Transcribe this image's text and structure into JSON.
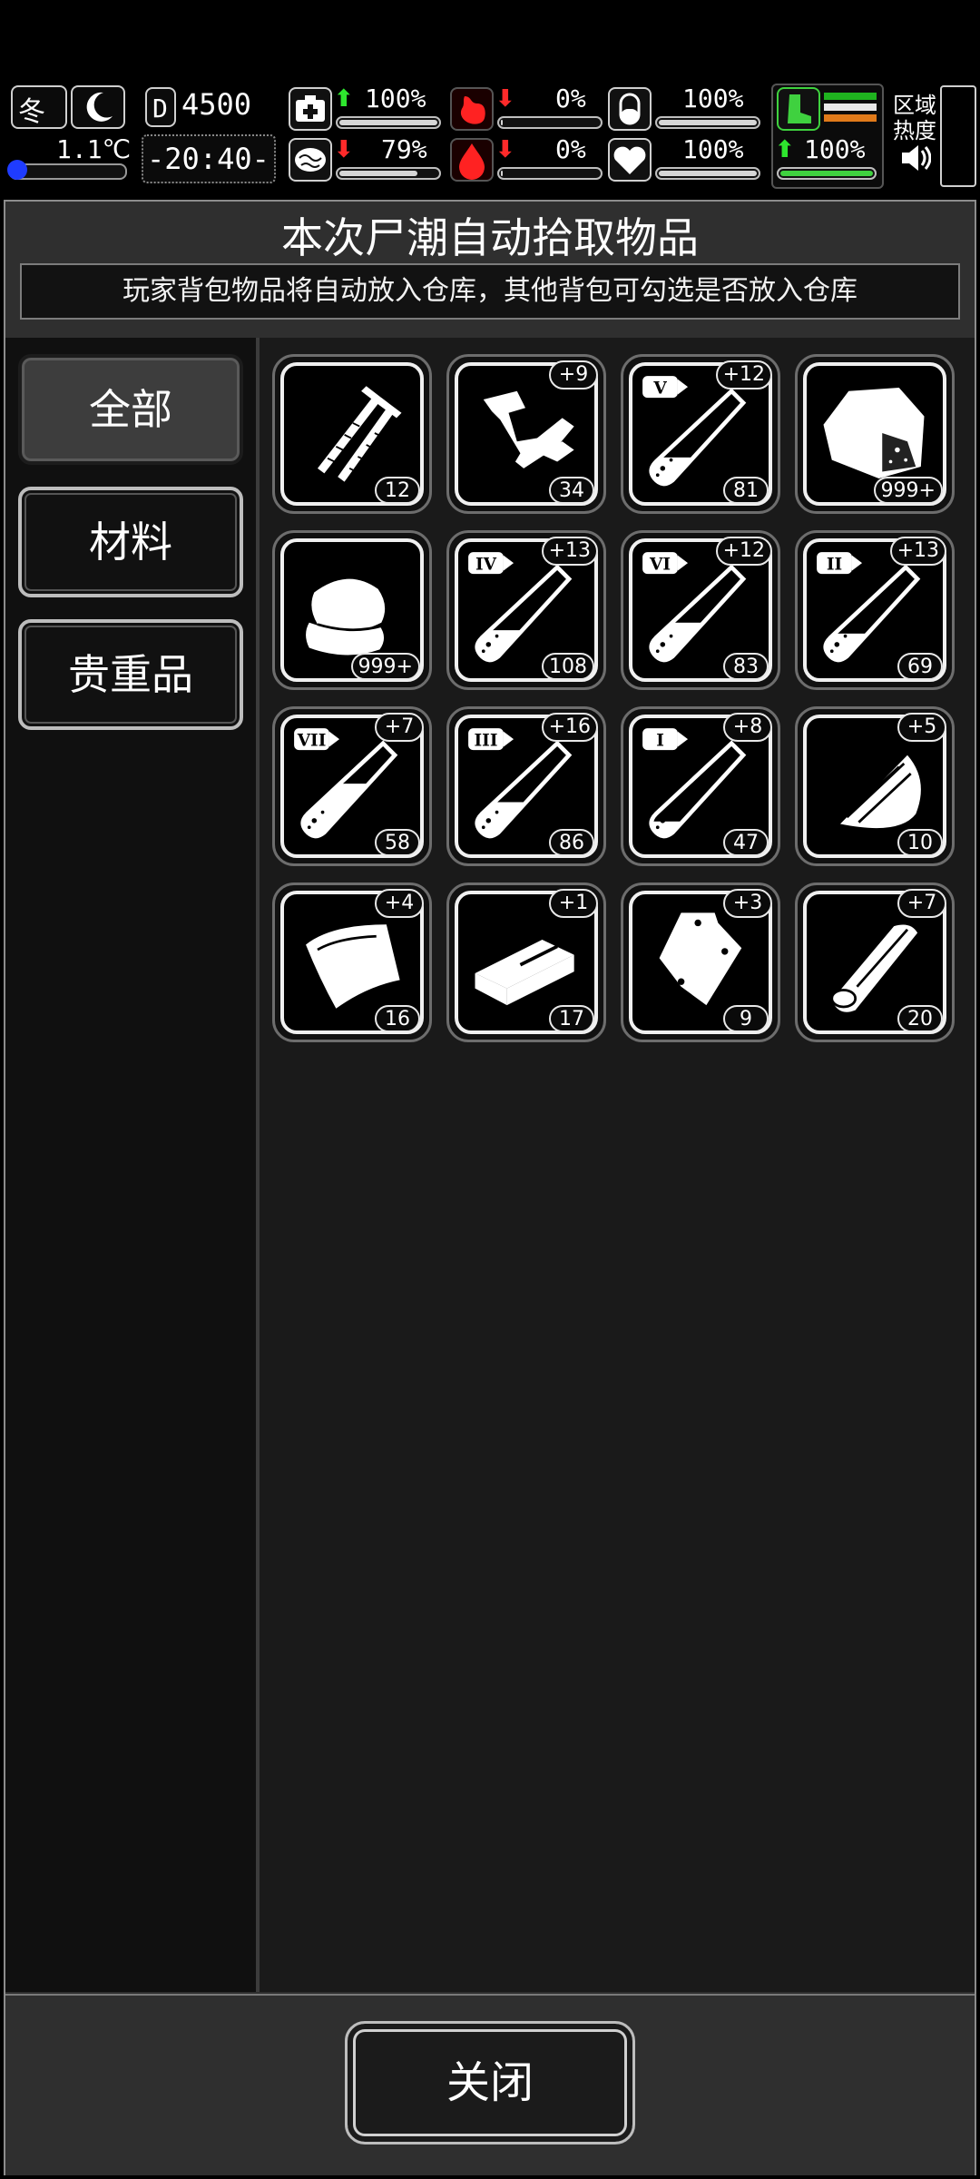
{
  "hud": {
    "season": "冬",
    "temperature": "1.1℃",
    "money": "4500",
    "time": "-20:40-",
    "stats": [
      {
        "name": "health",
        "value": "100%",
        "trend": "up",
        "fill": 1.0
      },
      {
        "name": "hunger",
        "value": "0%",
        "trend": "down",
        "fill": 0.0
      },
      {
        "name": "pill",
        "value": "100%",
        "trend": "none",
        "fill": 1.0
      },
      {
        "name": "brain",
        "value": "79%",
        "trend": "down",
        "fill": 0.79
      },
      {
        "name": "blood",
        "value": "0%",
        "trend": "down",
        "fill": 0.0
      },
      {
        "name": "heart",
        "value": "100%",
        "trend": "none",
        "fill": 1.0
      }
    ],
    "stamina": "100%",
    "region_heat_label": "区域热度"
  },
  "dialog": {
    "title": "本次尸潮自动拾取物品",
    "subtitle": "玩家背包物品将自动放入仓库，其他背包可勾选是否放入仓库",
    "tabs": [
      "全部",
      "材料",
      "贵重品"
    ],
    "active_tab": 0,
    "close_label": "关闭"
  },
  "items": [
    {
      "icon": "nails-icon",
      "count": "12",
      "plus": ""
    },
    {
      "icon": "scrap-metal-icon",
      "count": "34",
      "plus": "+9"
    },
    {
      "icon": "test-tube-v-icon",
      "roman": "V",
      "count": "81",
      "plus": "+12"
    },
    {
      "icon": "ore-rock-icon",
      "count": "999+",
      "plus": ""
    },
    {
      "icon": "cloth-icon",
      "count": "999+",
      "plus": ""
    },
    {
      "icon": "test-tube-iv-icon",
      "roman": "IV",
      "count": "108",
      "plus": "+13"
    },
    {
      "icon": "test-tube-vi-icon",
      "roman": "VI",
      "count": "83",
      "plus": "+12"
    },
    {
      "icon": "test-tube-ii-icon",
      "roman": "II",
      "count": "69",
      "plus": "+13"
    },
    {
      "icon": "test-tube-vii-icon",
      "roman": "VII",
      "count": "58",
      "plus": "+7"
    },
    {
      "icon": "test-tube-iii-icon",
      "roman": "III",
      "count": "86",
      "plus": "+16"
    },
    {
      "icon": "test-tube-i-icon",
      "roman": "I",
      "count": "47",
      "plus": "+8"
    },
    {
      "icon": "wood-chips-icon",
      "count": "10",
      "plus": "+5"
    },
    {
      "icon": "leather-hide-icon",
      "count": "16",
      "plus": "+4"
    },
    {
      "icon": "brick-icon",
      "count": "17",
      "plus": "+1"
    },
    {
      "icon": "plastic-bag-icon",
      "count": "9",
      "plus": "+3"
    },
    {
      "icon": "wood-log-icon",
      "count": "20",
      "plus": "+7"
    }
  ]
}
